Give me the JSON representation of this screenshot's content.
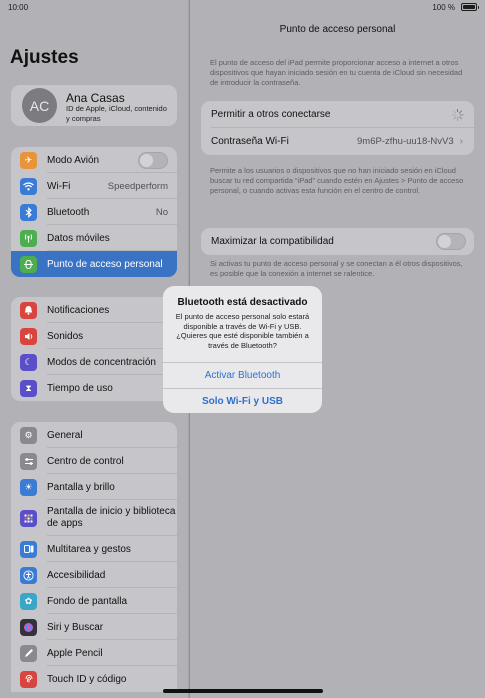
{
  "status": {
    "time": "10:00",
    "battery": "100 %"
  },
  "sidebar": {
    "title": "Ajustes",
    "profile": {
      "initials": "AC",
      "name": "Ana Casas",
      "subtitle": "ID de Apple, iCloud, contenido y compras"
    },
    "group1": [
      {
        "label": "Modo Avión",
        "icon": "airplane-icon",
        "color": "#e8943a",
        "toggle": false
      },
      {
        "label": "Wi-Fi",
        "icon": "wifi-icon",
        "color": "#3a7bd5",
        "value": "Speedperform"
      },
      {
        "label": "Bluetooth",
        "icon": "bluetooth-icon",
        "color": "#3a7bd5",
        "value": "No"
      },
      {
        "label": "Datos móviles",
        "icon": "antenna-icon",
        "color": "#4cae4f"
      },
      {
        "label": "Punto de acceso personal",
        "icon": "hotspot-icon",
        "color": "#4cae4f",
        "selected": true
      }
    ],
    "group2": [
      {
        "label": "Notificaciones",
        "icon": "bell-icon",
        "color": "#d8453e"
      },
      {
        "label": "Sonidos",
        "icon": "speaker-icon",
        "color": "#d8453e"
      },
      {
        "label": "Modos de concentración",
        "icon": "moon-icon",
        "color": "#5b4fc9"
      },
      {
        "label": "Tiempo de uso",
        "icon": "hourglass-icon",
        "color": "#5b4fc9"
      }
    ],
    "group3": [
      {
        "label": "General",
        "icon": "gear-icon",
        "color": "#8a8a8e"
      },
      {
        "label": "Centro de control",
        "icon": "sliders-icon",
        "color": "#8a8a8e"
      },
      {
        "label": "Pantalla y brillo",
        "icon": "brightness-icon",
        "color": "#3a7bd5"
      },
      {
        "label": "Pantalla de inicio y biblioteca de apps",
        "icon": "grid-icon",
        "color": "#5b4fc9"
      },
      {
        "label": "Multitarea y gestos",
        "icon": "multitask-icon",
        "color": "#3a7bd5"
      },
      {
        "label": "Accesibilidad",
        "icon": "accessibility-icon",
        "color": "#3a7bd5"
      },
      {
        "label": "Fondo de pantalla",
        "icon": "flower-icon",
        "color": "#3aa6c9"
      },
      {
        "label": "Siri y Buscar",
        "icon": "siri-icon",
        "color": "#333338"
      },
      {
        "label": "Apple Pencil",
        "icon": "pencil-icon",
        "color": "#8a8a8e"
      },
      {
        "label": "Touch ID y código",
        "icon": "fingerprint-icon",
        "color": "#d8453e"
      }
    ]
  },
  "detail": {
    "title": "Punto de acceso personal",
    "intro": "El punto de acceso del iPad permite proporcionar acceso a internet a otros dispositivos que hayan iniciado sesión en tu cuenta de iCloud sin necesidad de introducir la contraseña.",
    "allow_label": "Permitir a otros conectarse",
    "password_label": "Contraseña Wi-Fi",
    "password_value": "9m6P-zfhu-uu18-NvV3",
    "family_note": "Permite a los usuarios o dispositivos que no han iniciado sesión en iCloud buscar tu red compartida “iPad” cuando estén en Ajustes > Punto de acceso personal, o cuando activas esta función en el centro de control.",
    "compat_label": "Maximizar la compatibilidad",
    "compat_note": "Si activas tu punto de acceso personal y se conectan a él otros dispositivos, es posible que la conexión a internet se ralentice."
  },
  "alert": {
    "title": "Bluetooth está desactivado",
    "message": "El punto de acceso personal solo estará disponible a través de Wi-Fi y USB. ¿Quieres que esté disponible también a través de Bluetooth?",
    "button_activate": "Activar Bluetooth",
    "button_wifi_usb": "Solo Wi-Fi y USB"
  }
}
